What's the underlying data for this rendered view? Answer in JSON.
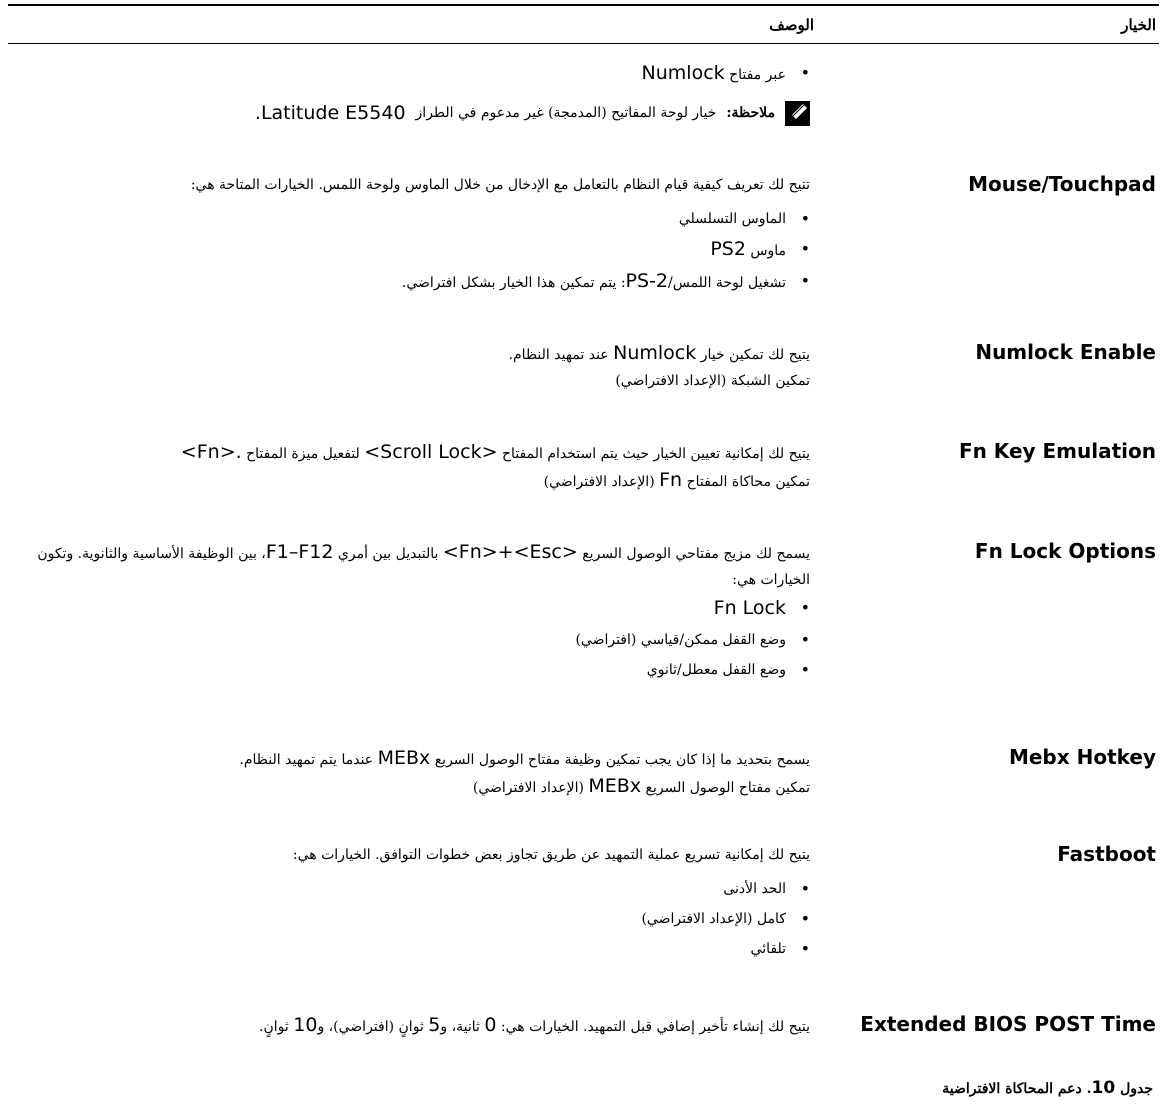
{
  "table": {
    "header_option": "الخيار",
    "header_description": "الوصف"
  },
  "top": {
    "bullet_text": "عبر مفتاح",
    "bullet_latin": "Numlock",
    "note_label": "ملاحظة:",
    "note_text": "خيار لوحة المفاتيح (المدمجة) غير مدعوم في الطراز",
    "note_model": "Latitude E5540."
  },
  "rows": [
    {
      "name": "Mouse/Touchpad",
      "intro": "تتيح لك تعريف كيفية قيام النظام بالتعامل مع الإدخال من خلال الماوس ولوحة اللمس. الخيارات المتاحة هي:",
      "bullets": [
        "الماوس التسلسلي",
        "ماوس",
        "تشغيل لوحة اللمس/",
        ": يتم تمكين هذا الخيار بشكل افتراضي."
      ],
      "latin": [
        "PS2",
        "PS-2"
      ]
    },
    {
      "name": "Numlock Enable",
      "line1_a": "يتيح لك تمكين خيار",
      "line1_latin": "Numlock",
      "line1_b": "عند تمهيد النظام.",
      "line2": "تمكين الشبكة (الإعداد الافتراضي)"
    },
    {
      "name": "Fn Key Emulation",
      "line1_a": "يتيح لك إمكانية تعيين الخيار حيث يتم استخدام المفتاح",
      "line1_latin1": "<Scroll Lock>",
      "line1_b": "لتفعيل ميزة المفتاح",
      "line1_latin2": "<Fn>.",
      "line2_a": "تمكين محاكاة المفتاح",
      "line2_latin": "Fn",
      "line2_b": "(الإعداد الافتراضي)"
    },
    {
      "name": "Fn Lock Options",
      "line1_a": "يسمح لك مزيج مفتاحي الوصول السريع",
      "line1_latin1": "<Fn>+<Esc>",
      "line1_b": "بالتبديل بين أمري",
      "line1_latin2": "F1–F12",
      "line1_c": "، بين الوظيفة الأساسية والثانوية. وتكون",
      "line2": "الخيارات هي:",
      "bullets": [
        "Fn Lock",
        "وضع القفل ممكن/قياسي (افتراضي)",
        "وضع القفل معطل/ثانوي"
      ]
    },
    {
      "name": "Mebx Hotkey",
      "line1_a": "يسمح بتحديد ما إذا كان يجب تمكين وظيفة مفتاح الوصول السريع",
      "line1_latin": "MEBx",
      "line1_b": "عندما يتم تمهيد النظام.",
      "line2_a": "تمكين مفتاح الوصول السريع",
      "line2_latin": "MEBx",
      "line2_b": "(الإعداد الافتراضي)"
    },
    {
      "name": "Fastboot",
      "intro": "يتيح لك إمكانية تسريع عملية التمهيد عن طريق تجاوز بعض خطوات التوافق. الخيارات هي:",
      "bullets": [
        "الحد الأدنى",
        "كامل (الإعداد الافتراضي)",
        "تلقائي"
      ]
    },
    {
      "name": "Extended BIOS POST Time",
      "text_a": "يتيح لك إنشاء تأخير إضافي قبل التمهيد. الخيارات هي:",
      "n0": "0",
      "text_b": "ثانية، و",
      "n5": "5",
      "text_c": "ثوانٍ (افتراضي)، و",
      "n10": "10",
      "text_d": "ثوانٍ."
    }
  ],
  "caption": {
    "prefix": "جدول",
    "number": "10",
    "text": ". دعم المحاكاة الافتراضية"
  },
  "bullet_glyph": "•"
}
